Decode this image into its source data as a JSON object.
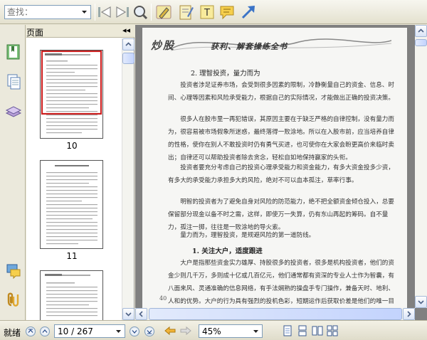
{
  "toolbar": {
    "search_placeholder": "查找：",
    "icons": [
      "previous-result-icon",
      "next-result-icon",
      "find-icon",
      "pencil-tool-icon",
      "notepad-icon",
      "text-tool-icon",
      "note-icon",
      "arrow-tool-icon"
    ]
  },
  "sidebar": {
    "title": "页面",
    "collapse_glyph": "◂◂",
    "thumbnails": [
      {
        "page_label": "10",
        "selected": true
      },
      {
        "page_label": "11",
        "selected": false
      }
    ]
  },
  "document": {
    "brand": "炒股",
    "subtitle": "获利、解套操练全书",
    "section_heading": "2. 理智投资，量力而为",
    "paragraphs": [
      "投资者涉足证券市场，会受到很多因素的限制，冷静衡量自己的资金、信息、时间、心理等因素和风险承受能力，根据自己的实际情况，才能做出正确的投资决策。",
      "很多人在股市里一再犯错误，其原因主要在于缺乏严格的自律控制，没有量力而为，很容易被市场假象所迷惑，最终落得一败涂地。所以在入股市前，应当培养自律的性格，使你在别人不敢投资时仍有勇气买进，也可使你在大家会盼更高价来临时卖出；自律还可以帮助投资者除去贪念，轻松自如地保持赢家的头衔。",
      "投资者要充分考虑自己的投资心理承受能力和资金能力，有多大资金投多少资，有多大的承受能力承担多大的风险，绝对不可以血本孤注，草率行事。",
      "明智的投资者为了避免自身对风险的防范能力，绝不把全额资金倾仓投入，总要保留部分现金以备不时之需，这样，即使万一失算，仍有东山再起的筹码。自不量力，孤注一掷，往往是一败涂地的导火索。",
      "量力而为，理智投资，是规避风险的第一道防线。"
    ],
    "subsection_heading": "1. 关注大户，适度跟进",
    "paragraphs_2": [
      "大户是指那些资金实力雄厚、持股很多的投资者，很多是机构投资者，他们的资金少则几千万，多则成十亿或几百亿元，他们通常都有资深的专业人士作为智囊，有八面来风、灵通准确的信息网络，有手法娴熟的操盘手专门操作，兼备天时、地利、人和的优势。大户的行为具有强烈的投机色彩，短期运作后获取价差是他们的唯一目的。"
    ],
    "page_side_number": "40"
  },
  "statusbar": {
    "status": "就绪",
    "page_indicator": "10 / 267",
    "zoom": "45%"
  }
}
